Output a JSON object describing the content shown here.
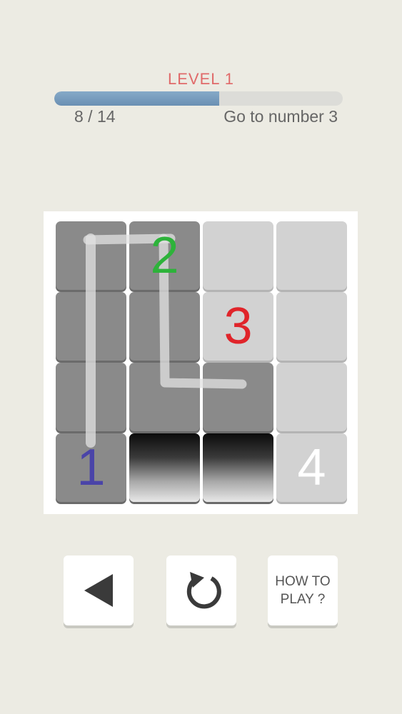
{
  "header": {
    "level_title": "LEVEL 1",
    "progress_current": 8,
    "progress_total": 14,
    "progress_label": "8 / 14",
    "goal_text": "Go to number 3"
  },
  "colors": {
    "level_title": "#e06a6a",
    "progress_fill": "#7a9fc2",
    "num_1": "#4a44a8",
    "num_2": "#2db33a",
    "num_3": "#e0242a",
    "num_4": "#ffffff"
  },
  "board": {
    "rows": 4,
    "cols": 4,
    "cells": [
      {
        "row": 0,
        "col": 0,
        "state": "visited",
        "number": ""
      },
      {
        "row": 0,
        "col": 1,
        "state": "visited",
        "number": "2",
        "color": "#2db33a"
      },
      {
        "row": 0,
        "col": 2,
        "state": "empty",
        "number": ""
      },
      {
        "row": 0,
        "col": 3,
        "state": "empty",
        "number": ""
      },
      {
        "row": 1,
        "col": 0,
        "state": "visited",
        "number": ""
      },
      {
        "row": 1,
        "col": 1,
        "state": "visited",
        "number": ""
      },
      {
        "row": 1,
        "col": 2,
        "state": "empty",
        "number": "3",
        "color": "#e0242a"
      },
      {
        "row": 1,
        "col": 3,
        "state": "empty",
        "number": ""
      },
      {
        "row": 2,
        "col": 0,
        "state": "visited",
        "number": ""
      },
      {
        "row": 2,
        "col": 1,
        "state": "visited",
        "number": ""
      },
      {
        "row": 2,
        "col": 2,
        "state": "visited",
        "number": ""
      },
      {
        "row": 2,
        "col": 3,
        "state": "empty",
        "number": ""
      },
      {
        "row": 3,
        "col": 0,
        "state": "visited",
        "number": "1",
        "color": "#4a44a8"
      },
      {
        "row": 3,
        "col": 1,
        "state": "hole",
        "number": ""
      },
      {
        "row": 3,
        "col": 2,
        "state": "hole",
        "number": ""
      },
      {
        "row": 3,
        "col": 3,
        "state": "empty",
        "number": "4",
        "color": "#ffffff"
      }
    ]
  },
  "controls": {
    "back_icon": "triangle-left-icon",
    "restart_icon": "restart-icon",
    "how_to_play_line1": "HOW TO",
    "how_to_play_line2": "PLAY ?"
  }
}
